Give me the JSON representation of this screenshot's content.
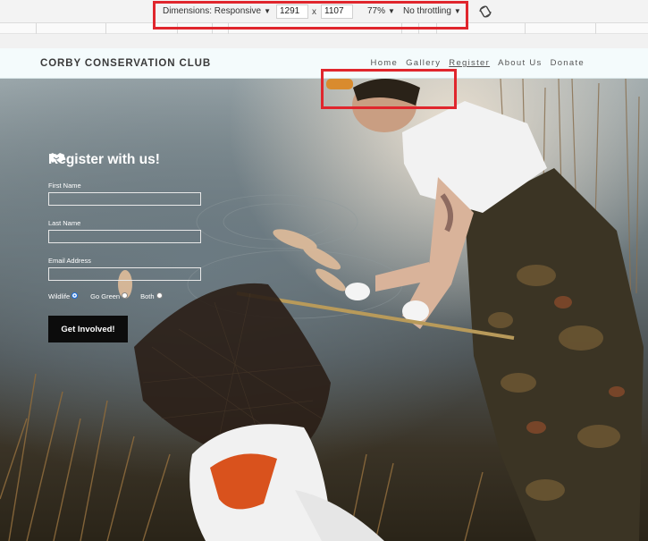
{
  "devtools": {
    "dimensions_label": "Dimensions: Responsive",
    "width_value": "1291",
    "times_sign": "x",
    "height_value": "1107",
    "zoom": "77%",
    "throttling": "No throttling",
    "caret": "▼"
  },
  "site": {
    "brand": "CORBY CONSERVATION CLUB",
    "nav": [
      {
        "label": "Home"
      },
      {
        "label": "Gallery"
      },
      {
        "label": "Register"
      },
      {
        "label": "About Us"
      },
      {
        "label": "Donate"
      }
    ]
  },
  "form": {
    "title": "Register with us!",
    "title_icon": "handshake-icon",
    "first_name_label": "First Name",
    "last_name_label": "Last Name",
    "email_label": "Email Address",
    "radios": [
      {
        "label": "Wildlife",
        "checked": true
      },
      {
        "label": "Go Green",
        "checked": false
      },
      {
        "label": "Both",
        "checked": false
      }
    ],
    "submit_label": "Get Involved!"
  },
  "colors": {
    "annotation_red": "#e0262d",
    "nav_background": "#f4fbfc",
    "button_black": "#0c0c0c",
    "radio_selected": "#1a6fe0"
  }
}
